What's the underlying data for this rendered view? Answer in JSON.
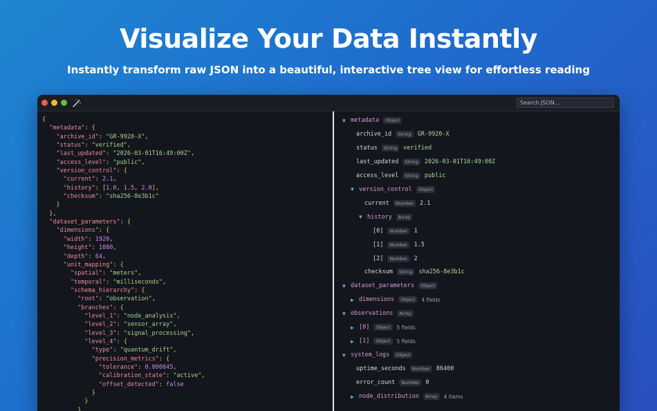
{
  "hero": {
    "title": "Visualize Your Data Instantly",
    "subtitle": "Instantly transform raw JSON into a beautiful, interactive tree view for effortless reading"
  },
  "window": {
    "search_placeholder": "Search JSON...",
    "icons": {
      "close": "close-dot",
      "minimize": "minimize-dot",
      "maximize": "maximize-dot",
      "tool": "magic-wand-icon"
    }
  },
  "colors": {
    "background": "#1f6ccc",
    "key": "#f08a9a",
    "string": "#a7d58a",
    "number": "#c98af0",
    "punctuation": "#e6c55a",
    "toggle": "#5ea8e8"
  },
  "code_lines": [
    [
      [
        "p",
        "{"
      ]
    ],
    [
      [
        "t",
        "  "
      ],
      [
        "k",
        "\"metadata\""
      ],
      [
        "p",
        ": {"
      ]
    ],
    [
      [
        "t",
        "    "
      ],
      [
        "k",
        "\"archive_id\""
      ],
      [
        "p",
        ": "
      ],
      [
        "s",
        "\"GR-9920-X\""
      ],
      [
        "p",
        ","
      ]
    ],
    [
      [
        "t",
        "    "
      ],
      [
        "k",
        "\"status\""
      ],
      [
        "p",
        ": "
      ],
      [
        "s",
        "\"verified\""
      ],
      [
        "p",
        ","
      ]
    ],
    [
      [
        "t",
        "    "
      ],
      [
        "k",
        "\"last_updated\""
      ],
      [
        "p",
        ": "
      ],
      [
        "s",
        "\"2026-03-01T16:49:00Z\""
      ],
      [
        "p",
        ","
      ]
    ],
    [
      [
        "t",
        "    "
      ],
      [
        "k",
        "\"access_level\""
      ],
      [
        "p",
        ": "
      ],
      [
        "s",
        "\"public\""
      ],
      [
        "p",
        ","
      ]
    ],
    [
      [
        "t",
        "    "
      ],
      [
        "k",
        "\"version_control\""
      ],
      [
        "p",
        ": {"
      ]
    ],
    [
      [
        "t",
        "      "
      ],
      [
        "k",
        "\"current\""
      ],
      [
        "p",
        ": "
      ],
      [
        "n",
        "2.1"
      ],
      [
        "p",
        ","
      ]
    ],
    [
      [
        "t",
        "      "
      ],
      [
        "k",
        "\"history\""
      ],
      [
        "p",
        ": ["
      ],
      [
        "n",
        "1.0"
      ],
      [
        "p",
        ", "
      ],
      [
        "n",
        "1.5"
      ],
      [
        "p",
        ", "
      ],
      [
        "n",
        "2.0"
      ],
      [
        "p",
        "],"
      ]
    ],
    [
      [
        "t",
        "      "
      ],
      [
        "k",
        "\"checksum\""
      ],
      [
        "p",
        ": "
      ],
      [
        "s",
        "\"sha256-8e3b1c\""
      ]
    ],
    [
      [
        "t",
        "    "
      ],
      [
        "p",
        "}"
      ]
    ],
    [
      [
        "t",
        "  "
      ],
      [
        "p",
        "},"
      ]
    ],
    [
      [
        "t",
        "  "
      ],
      [
        "k",
        "\"dataset_parameters\""
      ],
      [
        "p",
        ": {"
      ]
    ],
    [
      [
        "t",
        "    "
      ],
      [
        "k",
        "\"dimensions\""
      ],
      [
        "p",
        ": {"
      ]
    ],
    [
      [
        "t",
        "      "
      ],
      [
        "k",
        "\"width\""
      ],
      [
        "p",
        ": "
      ],
      [
        "n",
        "1920"
      ],
      [
        "p",
        ","
      ]
    ],
    [
      [
        "t",
        "      "
      ],
      [
        "k",
        "\"height\""
      ],
      [
        "p",
        ": "
      ],
      [
        "n",
        "1080"
      ],
      [
        "p",
        ","
      ]
    ],
    [
      [
        "t",
        "      "
      ],
      [
        "k",
        "\"depth\""
      ],
      [
        "p",
        ": "
      ],
      [
        "n",
        "64"
      ],
      [
        "p",
        ","
      ]
    ],
    [
      [
        "t",
        "      "
      ],
      [
        "k",
        "\"unit_mapping\""
      ],
      [
        "p",
        ": {"
      ]
    ],
    [
      [
        "t",
        "        "
      ],
      [
        "k",
        "\"spatial\""
      ],
      [
        "p",
        ": "
      ],
      [
        "s",
        "\"meters\""
      ],
      [
        "p",
        ","
      ]
    ],
    [
      [
        "t",
        "        "
      ],
      [
        "k",
        "\"temporal\""
      ],
      [
        "p",
        ": "
      ],
      [
        "s",
        "\"milliseconds\""
      ],
      [
        "p",
        ","
      ]
    ],
    [
      [
        "t",
        "        "
      ],
      [
        "k",
        "\"schema_hierarchy\""
      ],
      [
        "p",
        ": {"
      ]
    ],
    [
      [
        "t",
        "          "
      ],
      [
        "k",
        "\"root\""
      ],
      [
        "p",
        ": "
      ],
      [
        "s",
        "\"observation\""
      ],
      [
        "p",
        ","
      ]
    ],
    [
      [
        "t",
        "          "
      ],
      [
        "k",
        "\"branches\""
      ],
      [
        "p",
        ": {"
      ]
    ],
    [
      [
        "t",
        "            "
      ],
      [
        "k",
        "\"level_1\""
      ],
      [
        "p",
        ": "
      ],
      [
        "s",
        "\"node_analysis\""
      ],
      [
        "p",
        ","
      ]
    ],
    [
      [
        "t",
        "            "
      ],
      [
        "k",
        "\"level_2\""
      ],
      [
        "p",
        ": "
      ],
      [
        "s",
        "\"sensor_array\""
      ],
      [
        "p",
        ","
      ]
    ],
    [
      [
        "t",
        "            "
      ],
      [
        "k",
        "\"level_3\""
      ],
      [
        "p",
        ": "
      ],
      [
        "s",
        "\"signal_processing\""
      ],
      [
        "p",
        ","
      ]
    ],
    [
      [
        "t",
        "            "
      ],
      [
        "k",
        "\"level_4\""
      ],
      [
        "p",
        ": {"
      ]
    ],
    [
      [
        "t",
        "              "
      ],
      [
        "k",
        "\"type\""
      ],
      [
        "p",
        ": "
      ],
      [
        "s",
        "\"quantum_drift\""
      ],
      [
        "p",
        ","
      ]
    ],
    [
      [
        "t",
        "              "
      ],
      [
        "k",
        "\"precision_metrics\""
      ],
      [
        "p",
        ": {"
      ]
    ],
    [
      [
        "t",
        "                "
      ],
      [
        "k",
        "\"tolerance\""
      ],
      [
        "p",
        ": "
      ],
      [
        "n",
        "0.000045"
      ],
      [
        "p",
        ","
      ]
    ],
    [
      [
        "t",
        "                "
      ],
      [
        "k",
        "\"calibration_state\""
      ],
      [
        "p",
        ": "
      ],
      [
        "s",
        "\"active\""
      ],
      [
        "p",
        ","
      ]
    ],
    [
      [
        "t",
        "                "
      ],
      [
        "k",
        "\"offset_detected\""
      ],
      [
        "p",
        ": "
      ],
      [
        "b",
        "false"
      ]
    ],
    [
      [
        "t",
        "              "
      ],
      [
        "p",
        "}"
      ]
    ],
    [
      [
        "t",
        "            "
      ],
      [
        "p",
        "}"
      ]
    ],
    [
      [
        "t",
        "          "
      ],
      [
        "p",
        "}"
      ]
    ]
  ],
  "tree": [
    {
      "depth": 0,
      "toggle": "▼",
      "key": "metadata",
      "badge": "Object"
    },
    {
      "depth": 1,
      "key": "archive_id",
      "badge": "String",
      "value": "GR-9920-X"
    },
    {
      "depth": 1,
      "key": "status",
      "badge": "String",
      "value": "verified"
    },
    {
      "depth": 1,
      "key": "last_updated",
      "badge": "String",
      "value": "2026-03-01T16:49:00Z"
    },
    {
      "depth": 1,
      "key": "access_level",
      "badge": "String",
      "value": "public"
    },
    {
      "depth": 1,
      "toggle": "▼",
      "key": "version_control",
      "badge": "Object"
    },
    {
      "depth": 2,
      "key": "current",
      "badge": "Number",
      "value": "2.1"
    },
    {
      "depth": 2,
      "toggle": "▼",
      "key": "history",
      "badge": "Array"
    },
    {
      "depth": 3,
      "key": "[0]",
      "badge": "Number",
      "value": "1"
    },
    {
      "depth": 3,
      "key": "[1]",
      "badge": "Number",
      "value": "1.5"
    },
    {
      "depth": 3,
      "key": "[2]",
      "badge": "Number",
      "value": "2"
    },
    {
      "depth": 2,
      "key": "checksum",
      "badge": "String",
      "value": "sha256-8e3b1c"
    },
    {
      "depth": 0,
      "toggle": "▼",
      "key": "dataset_parameters",
      "badge": "Object"
    },
    {
      "depth": 1,
      "toggle": "▶",
      "key": "dimensions",
      "badge": "Object",
      "count": "4 fields"
    },
    {
      "depth": 0,
      "toggle": "▼",
      "key": "observations",
      "badge": "Array"
    },
    {
      "depth": 1,
      "toggle": "▶",
      "key": "[0]",
      "badge": "Object",
      "count": "5 fields"
    },
    {
      "depth": 1,
      "toggle": "▶",
      "key": "[1]",
      "badge": "Object",
      "count": "5 fields"
    },
    {
      "depth": 0,
      "toggle": "▼",
      "key": "system_logs",
      "badge": "Object"
    },
    {
      "depth": 1,
      "key": "uptime_seconds",
      "badge": "Number",
      "value": "86400"
    },
    {
      "depth": 1,
      "key": "error_count",
      "badge": "Number",
      "value": "0"
    },
    {
      "depth": 1,
      "toggle": "▶",
      "key": "node_distribution",
      "badge": "Array",
      "count": "4 items"
    }
  ]
}
